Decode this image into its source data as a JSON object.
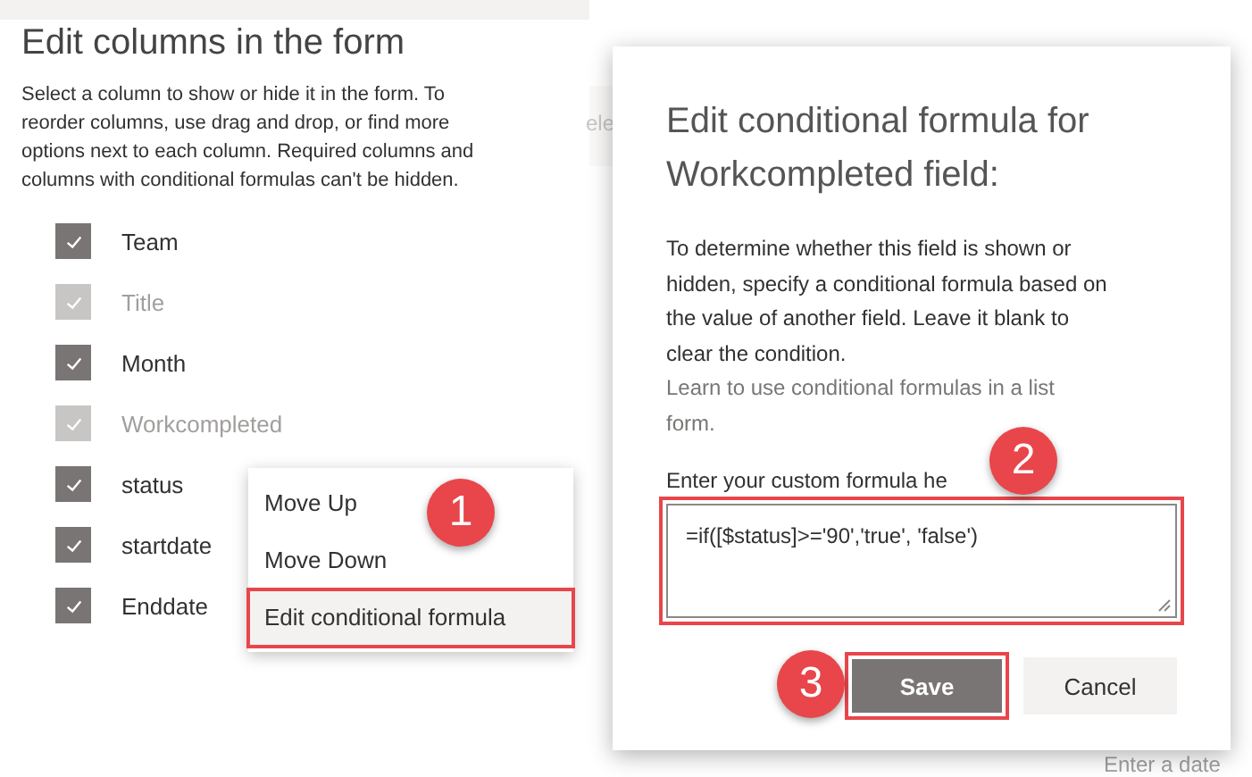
{
  "panel": {
    "title": "Edit columns in the form",
    "description": "Select a column to show or hide it in the form. To reorder columns, use drag and drop, or find more options next to each column. Required columns and columns with conditional formulas can't be hidden."
  },
  "columns": [
    {
      "name": "Team",
      "checked": true,
      "disabled": false
    },
    {
      "name": "Title",
      "checked": true,
      "disabled": true
    },
    {
      "name": "Month",
      "checked": true,
      "disabled": false
    },
    {
      "name": "Workcompleted",
      "checked": true,
      "disabled": true
    },
    {
      "name": "status",
      "checked": true,
      "disabled": false
    },
    {
      "name": "startdate",
      "checked": true,
      "disabled": false
    },
    {
      "name": "Enddate",
      "checked": true,
      "disabled": false
    }
  ],
  "context_menu": {
    "items": [
      {
        "label": "Move Up",
        "selected": false,
        "highlighted": false
      },
      {
        "label": "Move Down",
        "selected": false,
        "highlighted": false
      },
      {
        "label": "Edit conditional formula",
        "selected": true,
        "highlighted": true
      }
    ]
  },
  "dialog": {
    "title": "Edit conditional formula for Workcompleted field:",
    "description": "To determine whether this field is shown or hidden, specify a conditional formula based on the value of another field. Leave it blank to clear the condition.",
    "link": "Learn to use conditional formulas in a list form.",
    "field_label": "Enter your custom formula he",
    "formula": "=if([$status]>='90','true', 'false')",
    "formula_highlighted": true,
    "buttons": [
      {
        "label": "Save",
        "kind": "primary",
        "highlighted": true
      },
      {
        "label": "Cancel",
        "kind": "secondary",
        "highlighted": false
      }
    ]
  },
  "callouts": [
    "1",
    "2",
    "3"
  ],
  "background_texts": [
    "ele",
    "Enter a date"
  ]
}
